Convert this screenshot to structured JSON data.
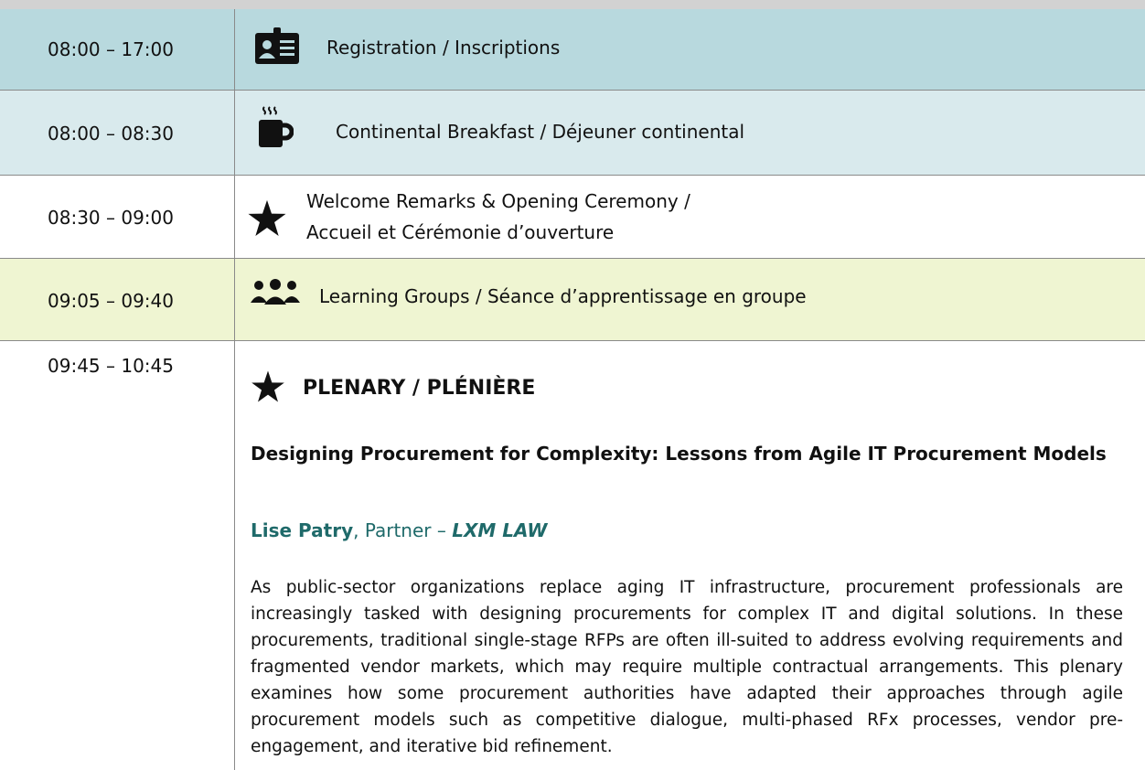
{
  "colors": {
    "teal": "#b8d9de",
    "teal_light": "#d9eaed",
    "lime": "#eff5d2",
    "speaker": "#1f6a6a"
  },
  "rows": [
    {
      "time": "08:00 – 17:00",
      "label": "Registration / Inscriptions",
      "icon": "id-card-icon"
    },
    {
      "time": "08:00 – 08:30",
      "label": "Continental Breakfast / Déjeuner continental",
      "icon": "coffee-icon"
    },
    {
      "time": "08:30 – 09:00",
      "label_line1": "Welcome Remarks & Opening Ceremony /",
      "label_line2": "Accueil et Cérémonie d’ouverture",
      "icon": "star-icon"
    },
    {
      "time": "09:05 – 09:40",
      "label": "Learning Groups / Séance d’apprentissage en groupe",
      "icon": "group-icon"
    },
    {
      "time": "09:45 – 10:45",
      "icon": "star-icon"
    }
  ],
  "plenary": {
    "heading": "PLENARY / PLÉNIÈRE",
    "title": "Designing Procurement for Complexity: Lessons from Agile IT Procurement Models",
    "speaker_name": "Lise Patry",
    "speaker_role": ", Partner – ",
    "speaker_org": "LXM LAW",
    "description": "As public-sector organizations replace aging IT infrastructure, procurement professionals are increasingly tasked with designing procurements for complex IT and digital solutions. In these procurements, traditional single-stage RFPs are often ill-suited to address evolving requirements and fragmented vendor markets, which may require multiple contractual arrangements. This plenary examines how some procurement authorities have adapted their approaches through agile procurement models such as competitive dialogue, multi-phased RFx processes, vendor pre-engagement, and iterative bid refinement."
  }
}
